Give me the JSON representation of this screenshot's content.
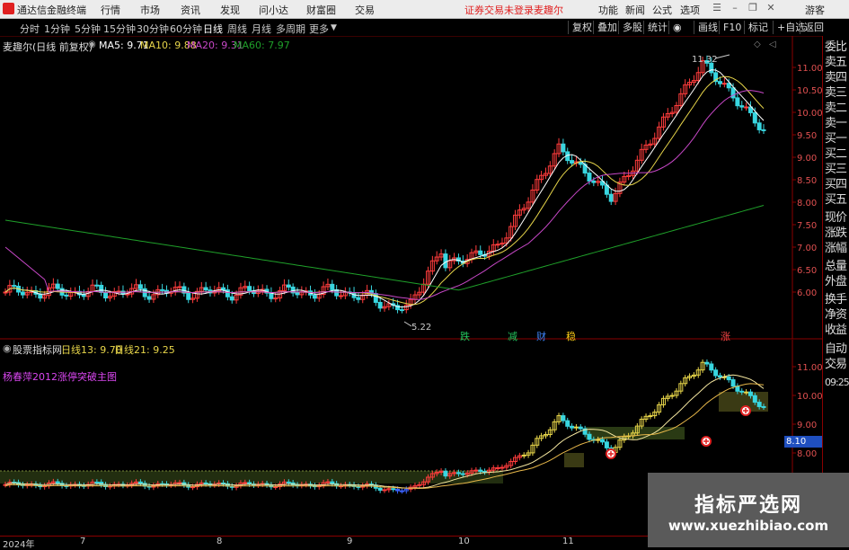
{
  "titlebar": {
    "app_name": "通达信金融终端",
    "menus": [
      "行情",
      "市场",
      "资讯",
      "发现",
      "问小达",
      "财富圈",
      "交易"
    ],
    "notice": "证券交易未登录",
    "stock_name": "麦趣尔",
    "tools": [
      "功能",
      "新闻",
      "公式",
      "选项"
    ],
    "user": "游客"
  },
  "toolbar": {
    "timeframes": [
      "分时",
      "1分钟",
      "5分钟",
      "15分钟",
      "30分钟",
      "60分钟",
      "日线",
      "周线",
      "月线",
      "多周期",
      "更多"
    ],
    "active_timeframe": "日线",
    "right_buttons": [
      "复权",
      "叠加",
      "多股",
      "统计",
      "画线",
      "F10",
      "标记",
      "+自选",
      "返回"
    ]
  },
  "main_chart": {
    "title": "麦趣尔(日线 前复权)",
    "ma5": "MA5: 9.71",
    "ma10": "MA10: 9.88",
    "ma20": "MA20: 9.31",
    "ma60": "MA60: 7.97",
    "high_label": "11.32",
    "low_label": "5.22",
    "price_axis": [
      "11.00",
      "10.50",
      "10.00",
      "9.50",
      "9.00",
      "8.50",
      "8.00",
      "7.50",
      "7.00",
      "6.50",
      "6.00"
    ],
    "signals": [
      {
        "text": "跌",
        "color": "#22c55e"
      },
      {
        "text": "减",
        "color": "#22c55e"
      },
      {
        "text": "财",
        "color": "#3b82f6"
      },
      {
        "text": "稳",
        "color": "#facc15"
      },
      {
        "text": "涨",
        "color": "#ef4444"
      }
    ]
  },
  "sub_chart": {
    "title": "股票指标网",
    "line13": "日线13: 9.70",
    "line21": "日线21: 9.25",
    "indicator_name": "杨春萍2012涨停突破主图",
    "price_axis": [
      "11.00",
      "10.00",
      "9.00",
      "8.00"
    ],
    "current_price": "8.10"
  },
  "date_axis": [
    "2024年",
    "7",
    "8",
    "9",
    "10",
    "11"
  ],
  "right_panel": {
    "items": [
      "委比",
      "卖五",
      "卖四",
      "卖三",
      "卖二",
      "卖一",
      "买一",
      "买二",
      "买三",
      "买四",
      "买五",
      "现价",
      "涨跌",
      "涨幅",
      "总量",
      "外盘",
      "换手",
      "净资",
      "收益",
      "自动",
      "交易",
      "09:25"
    ]
  },
  "watermark": {
    "title": "指标严选网",
    "url": "www.xuezhibiao.com"
  },
  "colors": {
    "up": "#ff3c3c",
    "down": "#38d6e0",
    "ma5": "#ffffff",
    "ma10": "#e8d64a",
    "ma20": "#c848c8",
    "ma60": "#1fa02a"
  }
}
